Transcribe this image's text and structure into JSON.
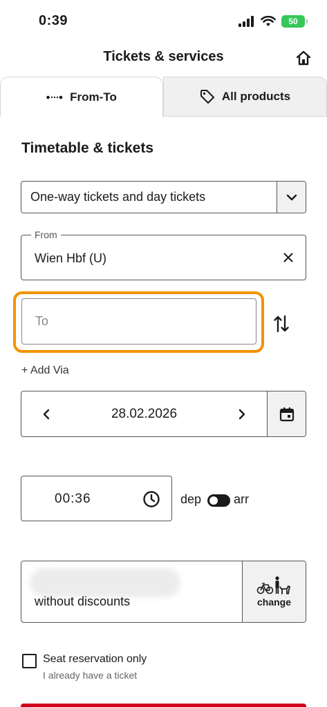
{
  "status_bar": {
    "time": "0:39",
    "battery": "50"
  },
  "header": {
    "title": "Tickets & services",
    "home_icon": "home-icon"
  },
  "tabs": [
    {
      "label": "From-To",
      "icon": "route-dots-icon",
      "active": true
    },
    {
      "label": "All products",
      "icon": "tag-icon",
      "active": false
    }
  ],
  "form": {
    "section_title": "Timetable & tickets",
    "ticket_type": "One-way tickets and day tickets",
    "from": {
      "legend": "From",
      "value": "Wien Hbf (U)"
    },
    "to": {
      "placeholder": "To",
      "value": ""
    },
    "add_via": "+ Add Via",
    "date": "28.02.2026",
    "time": "00:36",
    "dep_label": "dep",
    "arr_label": "arr",
    "passenger": {
      "discount": "without discounts",
      "change_label": "change"
    },
    "seat_reservation": {
      "label": "Seat reservation only",
      "sublabel": "I already have a ticket",
      "checked": false
    }
  },
  "colors": {
    "focus_outline": "#f39200",
    "primary_red": "#d0021b",
    "battery_green": "#35c759"
  }
}
